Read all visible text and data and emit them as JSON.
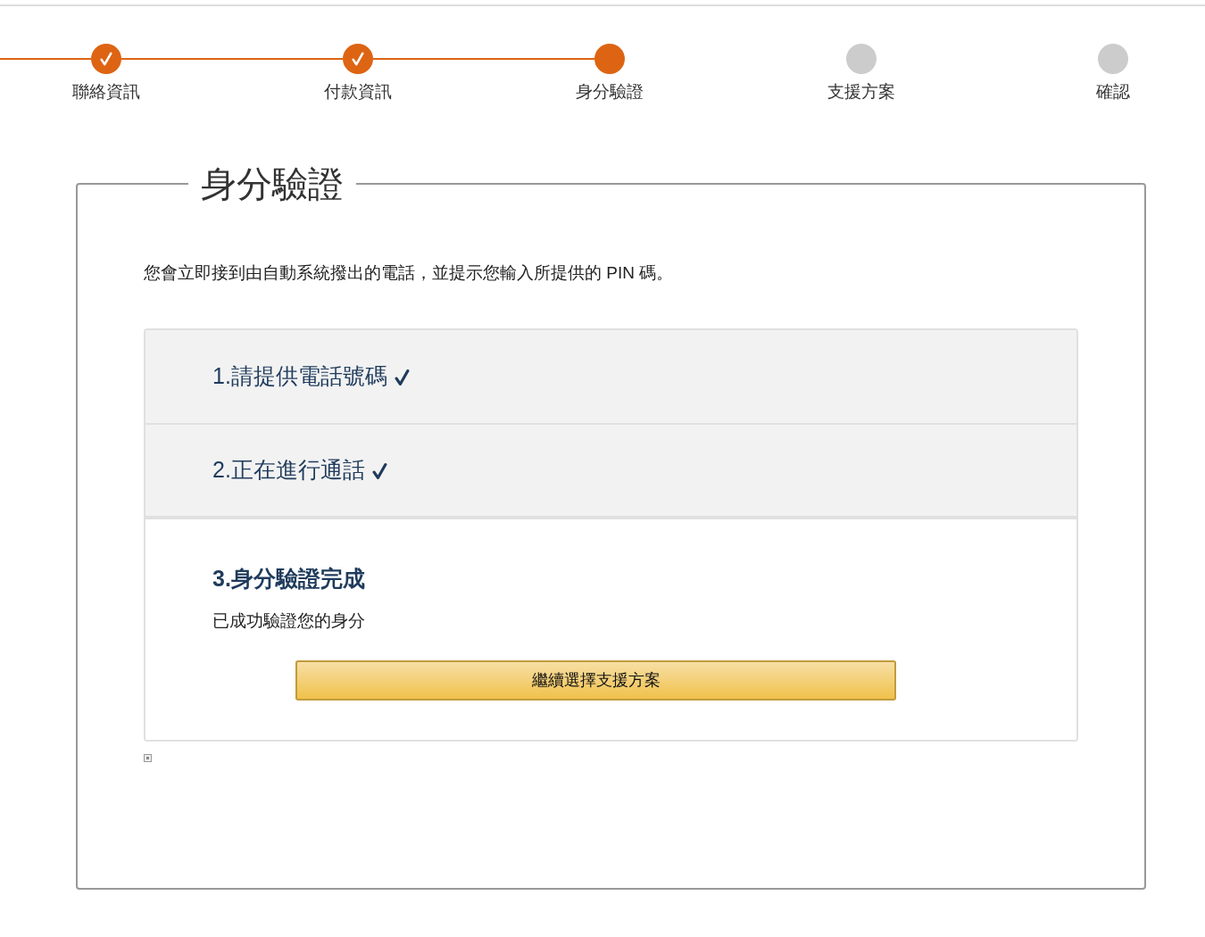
{
  "steps": [
    {
      "label": "聯絡資訊",
      "completed": true
    },
    {
      "label": "付款資訊",
      "completed": true
    },
    {
      "label": "身分驗證",
      "completed": false
    },
    {
      "label": "支援方案",
      "completed": false
    },
    {
      "label": "確認",
      "completed": false
    }
  ],
  "panel": {
    "title": "身分驗證",
    "intro": "您會立即接到由自動系統撥出的電話，並提示您輸入所提供的 PIN 碼。",
    "sections": [
      {
        "title": "1.請提供電話號碼",
        "completed": true,
        "expanded": false
      },
      {
        "title": "2.正在進行通話",
        "completed": true,
        "expanded": false
      },
      {
        "title": "3.身分驗證完成",
        "completed": false,
        "expanded": true,
        "message": "已成功驗證您的身分",
        "button": "繼續選擇支援方案"
      }
    ]
  }
}
